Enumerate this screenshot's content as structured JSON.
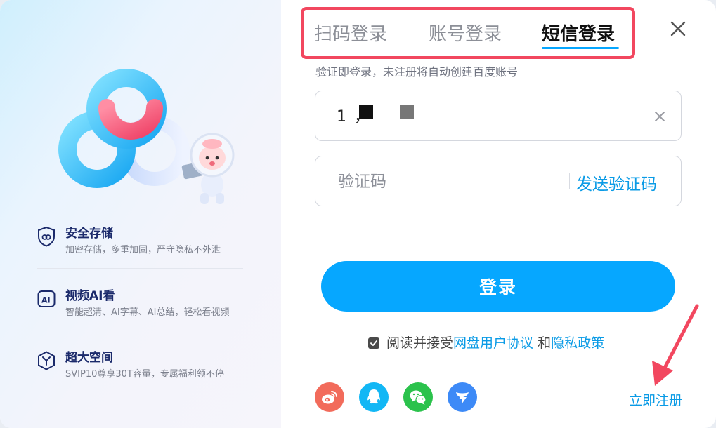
{
  "tabs": [
    {
      "label": "扫码登录",
      "active": false
    },
    {
      "label": "账号登录",
      "active": false
    },
    {
      "label": "短信登录",
      "active": true
    }
  ],
  "hint": "验证即登录，未注册将自动创建百度账号",
  "phone": {
    "value": "1          ，"
  },
  "code": {
    "placeholder": "验证码",
    "send_label": "发送验证码"
  },
  "login_button": "登录",
  "agreement": {
    "prefix": "阅读并接受",
    "terms": "网盘用户协议",
    "and": " 和",
    "privacy": "隐私政策",
    "checked": true
  },
  "register_label": "立即注册",
  "features": [
    {
      "title": "安全存储",
      "desc": "加密存储，多重加固，严守隐私不外泄",
      "icon": "shield-icon"
    },
    {
      "title": "视频AI看",
      "desc": "智能超清、AI字幕、AI总结，轻松看视频",
      "icon": "ai-video-icon"
    },
    {
      "title": "超大空间",
      "desc": "SVIP10尊享30T容量，专属福利领不停",
      "icon": "storage-icon"
    }
  ],
  "social": [
    {
      "name": "weibo-icon",
      "color": "#f26b5b"
    },
    {
      "name": "qq-icon",
      "color": "#12b7f5"
    },
    {
      "name": "wechat-icon",
      "color": "#2bc24c"
    },
    {
      "name": "dingtalk-icon",
      "color": "#3d8af7"
    }
  ],
  "colors": {
    "accent": "#06a7ff",
    "highlight_border": "#f2475f",
    "link": "#0a9be6"
  }
}
